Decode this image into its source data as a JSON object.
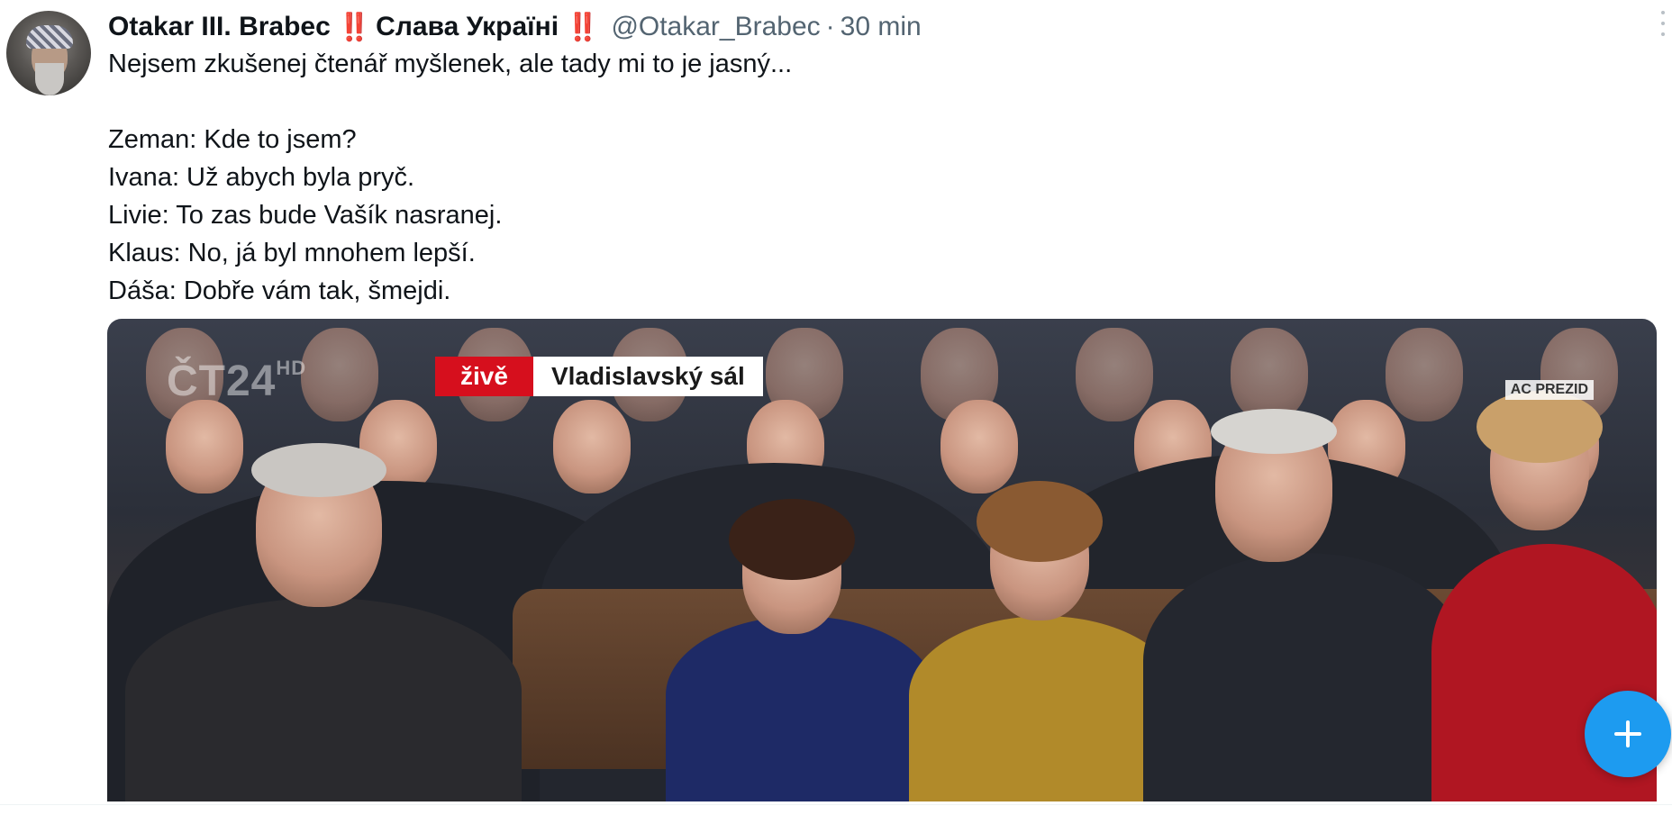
{
  "tweet": {
    "display_name": "Otakar III. Brabec",
    "emoji_1": "‼️",
    "slogan": "Слава Україні",
    "emoji_2": "‼️",
    "handle": "@Otakar_Brabec",
    "separator": "·",
    "time": "30 min",
    "text_lines": [
      "Nejsem zkušenej čtenář myšlenek, ale tady mi to je jasný...",
      "",
      "Zeman: Kde to jsem?",
      "Ivana: Už abych byla pryč.",
      "Livie: To zas bude Vašík nasranej.",
      "Klaus: No, já byl mnohem lepší.",
      "Dáša: Dobře vám tak, šmejdi."
    ]
  },
  "media": {
    "channel_logo": "ČT24",
    "channel_suffix": "HD",
    "live_label": "živě",
    "location_label": "Vladislavský sál",
    "watermark": "AC PREZID"
  },
  "icons": {
    "more": "more-vertical-icon",
    "fab": "plus-icon"
  },
  "colors": {
    "accent": "#1d9bf0",
    "live_red": "#d60f1d",
    "secondary_text": "#536471"
  }
}
